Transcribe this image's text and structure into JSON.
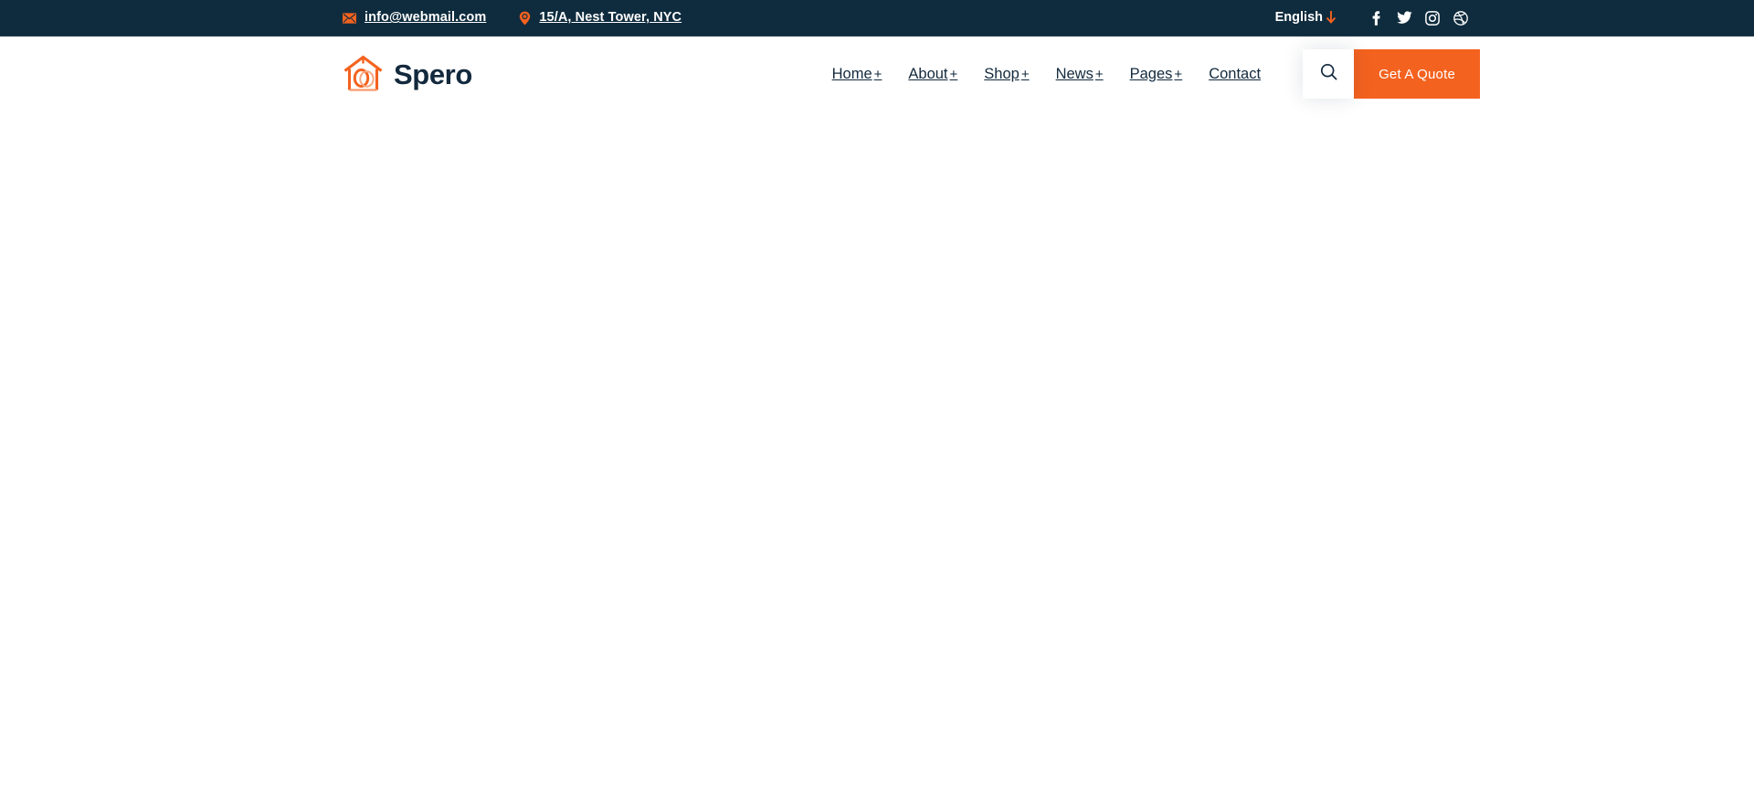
{
  "topbar": {
    "email": {
      "icon": "envelope-icon",
      "text": "info@webmail.com"
    },
    "address": {
      "icon": "map-pin-icon",
      "text": "15/A, Nest Tower, NYC"
    },
    "language": {
      "label": "English",
      "icon": "arrow-down-icon"
    },
    "socials": [
      {
        "name": "facebook-icon",
        "label": "Facebook"
      },
      {
        "name": "twitter-icon",
        "label": "Twitter"
      },
      {
        "name": "instagram-icon",
        "label": "Instagram"
      },
      {
        "name": "dribbble-icon",
        "label": "Dribbble"
      }
    ]
  },
  "header": {
    "brand": {
      "name": "Spero",
      "icon": "house-logo-icon"
    },
    "nav": [
      {
        "label": "Home",
        "plus": "+"
      },
      {
        "label": "About",
        "plus": "+"
      },
      {
        "label": "Shop",
        "plus": "+"
      },
      {
        "label": "News",
        "plus": "+"
      },
      {
        "label": "Pages",
        "plus": "+"
      },
      {
        "label": "Contact",
        "plus": ""
      }
    ],
    "search": {
      "icon": "search-icon"
    },
    "quote_button": {
      "label": "Get A Quote"
    }
  },
  "colors": {
    "accent": "#f4621f",
    "navy": "#0f2c3e",
    "text_dark": "#13293d",
    "white": "#ffffff"
  }
}
